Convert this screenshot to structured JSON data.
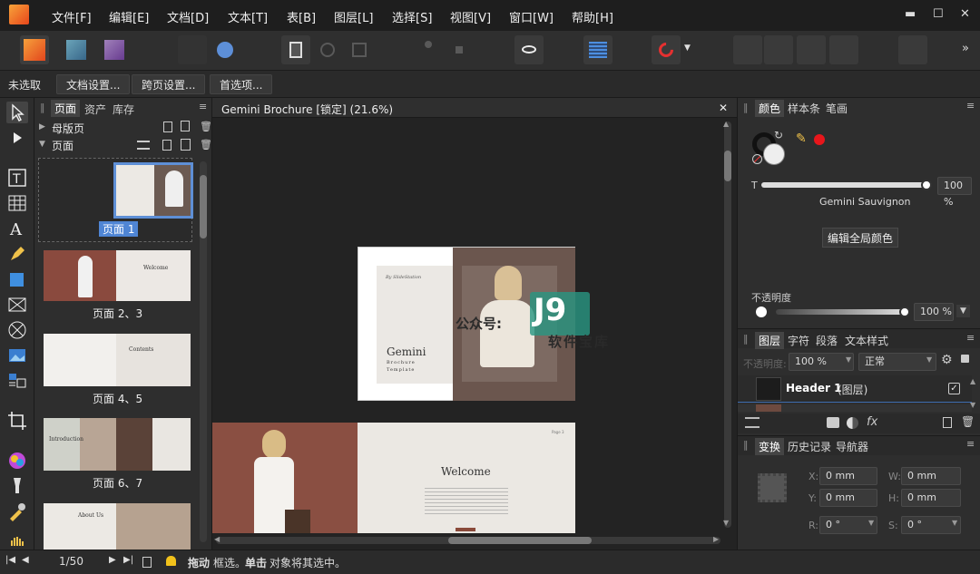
{
  "menubar": {
    "items": [
      "文件[F]",
      "编辑[E]",
      "文档[D]",
      "文本[T]",
      "表[B]",
      "图层[L]",
      "选择[S]",
      "视图[V]",
      "窗口[W]",
      "帮助[H]"
    ],
    "minimize": "▬",
    "maximize": "☐",
    "close": "✕"
  },
  "contextbar": {
    "status": "未选取",
    "doc_settings": "文档设置...",
    "spread_settings": "跨页设置...",
    "preferences": "首选项..."
  },
  "pages_panel": {
    "tabs": [
      "页面",
      "资产",
      "库存"
    ],
    "master_pages": "母版页",
    "pages": "页面",
    "thumbs": [
      {
        "label": "页面 1"
      },
      {
        "label": "页面 2、3",
        "text": "Welcome"
      },
      {
        "label": "页面 4、5",
        "text": "Contents"
      },
      {
        "label": "页面 6、7",
        "text": "Introduction"
      },
      {
        "label": "",
        "text": "About Us"
      }
    ]
  },
  "document": {
    "tab_title": "Gemini Brochure [锁定] (21.6%)",
    "close": "✕",
    "cover": {
      "byline": "By SlideStation",
      "title": "Gemini",
      "subtitle1": "Brochure",
      "subtitle2": "Template"
    },
    "spread": {
      "heading": "Welcome",
      "page_label": "Page 3"
    },
    "watermark": {
      "prefix": "公众号:",
      "brand": "J9",
      "sub": "软件宝库"
    }
  },
  "color_panel": {
    "tabs": [
      "颜色",
      "样本条",
      "笔画"
    ],
    "t_label": "T",
    "tint_value": "100 %",
    "swatch_name": "Gemini Sauvignon",
    "edit_global": "编辑全局颜色",
    "opacity_label": "不透明度",
    "opacity_value": "100 %",
    "active_color": "#e8161b"
  },
  "layers_panel": {
    "tabs": [
      "图层",
      "字符",
      "段落",
      "文本样式"
    ],
    "opacity_label": "不透明度:",
    "opacity_value": "100 %",
    "blend_mode": "正常",
    "layer_name": "Header 1",
    "layer_type": "(图层)"
  },
  "transform_panel": {
    "tabs": [
      "变换",
      "历史记录",
      "导航器"
    ],
    "x_label": "X:",
    "x_value": "0 mm",
    "y_label": "Y:",
    "y_value": "0 mm",
    "w_label": "W:",
    "w_value": "0 mm",
    "h_label": "H:",
    "h_value": "0 mm",
    "r_label": "R:",
    "r_value": "0 °",
    "s_label": "S:",
    "s_value": "0 °"
  },
  "statusbar": {
    "page_counter": "1/50",
    "drag": "拖动",
    "drag_text": "框选。",
    "click": "单击",
    "click_text": "对象将其选中。"
  }
}
